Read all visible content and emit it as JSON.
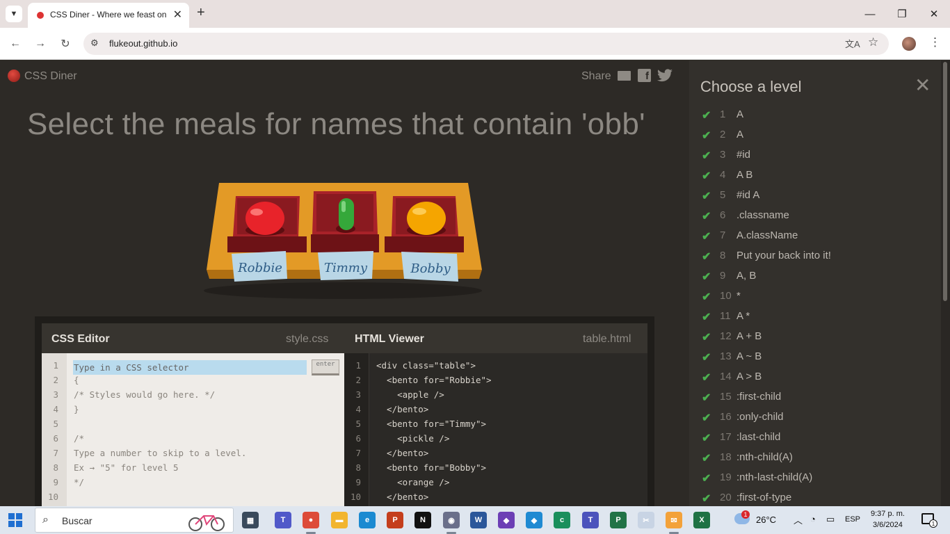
{
  "browser": {
    "tab_title": "CSS Diner - Where we feast on CSS",
    "url": "flukeout.github.io",
    "icons": [
      "chevron-down-icon",
      "close-icon",
      "plus-icon",
      "minimize-icon",
      "restore-icon",
      "back-icon",
      "forward-icon",
      "reload-icon",
      "site-info-icon",
      "translate-icon",
      "star-icon",
      "menu-icon"
    ]
  },
  "game": {
    "logo": "CSS Diner",
    "share": "Share",
    "instruction": "Select the meals for names that contain 'obb'",
    "plates": [
      {
        "name": "Robbie",
        "food": "apple",
        "color": "#e8232a"
      },
      {
        "name": "Timmy",
        "food": "pickle",
        "color": "#35a83a"
      },
      {
        "name": "Bobby",
        "food": "orange",
        "color": "#f5a500"
      }
    ]
  },
  "editor": {
    "css_label": "CSS Editor",
    "css_file": "style.css",
    "html_label": "HTML Viewer",
    "html_file": "table.html",
    "input_placeholder": "Type in a CSS selector",
    "enter_label": "enter",
    "css_lines": [
      "",
      "{",
      "/* Styles would go here. */",
      "}",
      "",
      "/*",
      "Type a number to skip to a level.",
      "Ex → \"5\" for level 5",
      "*/",
      ""
    ],
    "html_lines": [
      "<div class=\"table\">",
      "  <bento for=\"Robbie\">",
      "    <apple />",
      "  </bento>",
      "  <bento for=\"Timmy\">",
      "    <pickle />",
      "  </bento>",
      "  <bento for=\"Bobby\">",
      "    <orange />",
      "  </bento>"
    ]
  },
  "sidebar": {
    "title": "Choose a level",
    "levels": [
      {
        "num": "1",
        "name": "A",
        "done": true
      },
      {
        "num": "2",
        "name": "A",
        "done": true
      },
      {
        "num": "3",
        "name": "#id",
        "done": true
      },
      {
        "num": "4",
        "name": "A  B",
        "done": true
      },
      {
        "num": "5",
        "name": "#id  A",
        "done": true
      },
      {
        "num": "6",
        "name": ".classname",
        "done": true
      },
      {
        "num": "7",
        "name": "A.className",
        "done": true
      },
      {
        "num": "8",
        "name": "Put your back into it!",
        "done": true
      },
      {
        "num": "9",
        "name": "A, B",
        "done": true
      },
      {
        "num": "10",
        "name": "*",
        "done": true
      },
      {
        "num": "11",
        "name": "A  *",
        "done": true
      },
      {
        "num": "12",
        "name": "A + B",
        "done": true
      },
      {
        "num": "13",
        "name": "A ~ B",
        "done": true
      },
      {
        "num": "14",
        "name": "A > B",
        "done": true
      },
      {
        "num": "15",
        "name": ":first-child",
        "done": true
      },
      {
        "num": "16",
        "name": ":only-child",
        "done": true
      },
      {
        "num": "17",
        "name": ":last-child",
        "done": true
      },
      {
        "num": "18",
        "name": ":nth-child(A)",
        "done": true
      },
      {
        "num": "19",
        "name": ":nth-last-child(A)",
        "done": true
      },
      {
        "num": "20",
        "name": ":first-of-type",
        "done": true
      }
    ]
  },
  "taskbar": {
    "search_text": "Buscar",
    "weather_badge": "1",
    "temperature": "26°C",
    "language": "ESP",
    "time": "9:37 p. m.",
    "date": "3/6/2024",
    "notifications": "1",
    "apps": [
      {
        "name": "task-view",
        "color": "#3a4a5c",
        "glyph": "▦"
      },
      {
        "name": "teams",
        "color": "#5059c9",
        "glyph": "T"
      },
      {
        "name": "chrome",
        "color": "#dd4b39",
        "glyph": "●"
      },
      {
        "name": "file-explorer",
        "color": "#f2b52e",
        "glyph": "▬"
      },
      {
        "name": "edge",
        "color": "#1b8ad1",
        "glyph": "e"
      },
      {
        "name": "powerpoint",
        "color": "#c43e1c",
        "glyph": "P"
      },
      {
        "name": "netflix",
        "color": "#111111",
        "glyph": "N"
      },
      {
        "name": "media-app",
        "color": "#6a6f8a",
        "glyph": "◉"
      },
      {
        "name": "word",
        "color": "#2b579a",
        "glyph": "W"
      },
      {
        "name": "visual-studio",
        "color": "#6c3fb5",
        "glyph": "◆"
      },
      {
        "name": "vscode",
        "color": "#1f8ad2",
        "glyph": "◆"
      },
      {
        "name": "cricut",
        "color": "#1a8f5c",
        "glyph": "c"
      },
      {
        "name": "teams-classic",
        "color": "#4b53bc",
        "glyph": "T"
      },
      {
        "name": "project",
        "color": "#217346",
        "glyph": "P"
      },
      {
        "name": "snipping-tool",
        "color": "#c8d4e4",
        "glyph": "✂"
      },
      {
        "name": "mail",
        "color": "#f3a23a",
        "glyph": "✉"
      },
      {
        "name": "excel",
        "color": "#1f7244",
        "glyph": "X"
      }
    ]
  }
}
